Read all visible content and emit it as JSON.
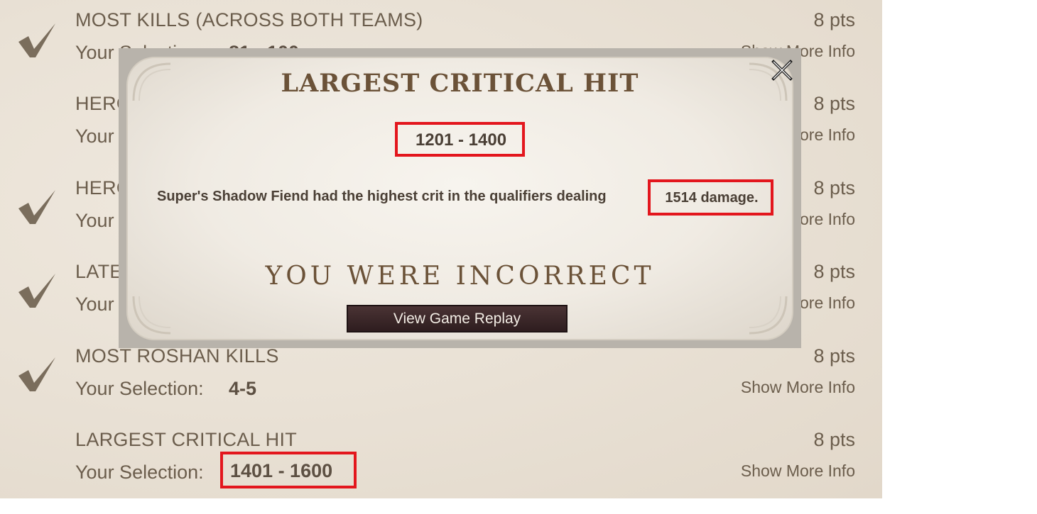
{
  "rows": [
    {
      "title": "MOST KILLS (ACROSS BOTH TEAMS)",
      "pts": "8 pts",
      "sel_label": "Your Selection:",
      "sel_value": "81 - 100",
      "more": "Show More Info"
    },
    {
      "title": "HERO",
      "pts": "8 pts",
      "sel_label": "Your",
      "more": "Show More Info"
    },
    {
      "title": "HERO",
      "pts": "8 pts",
      "sel_label": "Your",
      "more": "Show More Info"
    },
    {
      "title": "LATE",
      "pts": "8 pts",
      "sel_label": "Your",
      "more": "Show More Info"
    },
    {
      "title": "MOST ROSHAN KILLS",
      "pts": "8 pts",
      "sel_label": "Your Selection:",
      "sel_value": "4-5",
      "more": "Show More Info"
    },
    {
      "title": "LARGEST CRITICAL HIT",
      "pts": "8 pts",
      "sel_label": "Your Selection:",
      "sel_value": "1401 - 1600",
      "more": "Show More Info"
    }
  ],
  "modal": {
    "title": "LARGEST CRITICAL HIT",
    "range": "1201 - 1400",
    "description": "Super's Shadow Fiend  had the highest crit in the qualifiers dealing",
    "damage": "1514 damage.",
    "result": "YOU WERE INCORRECT",
    "replay_button": "View Game Replay"
  },
  "icons": {
    "check": "checkmark-icon",
    "close": "close-icon",
    "corner": "ornament-corner-icon"
  },
  "colors": {
    "highlight_box": "#e3161d",
    "text": "#6b5d4c",
    "title": "#6b5238",
    "button_bg": "#3a2628"
  }
}
